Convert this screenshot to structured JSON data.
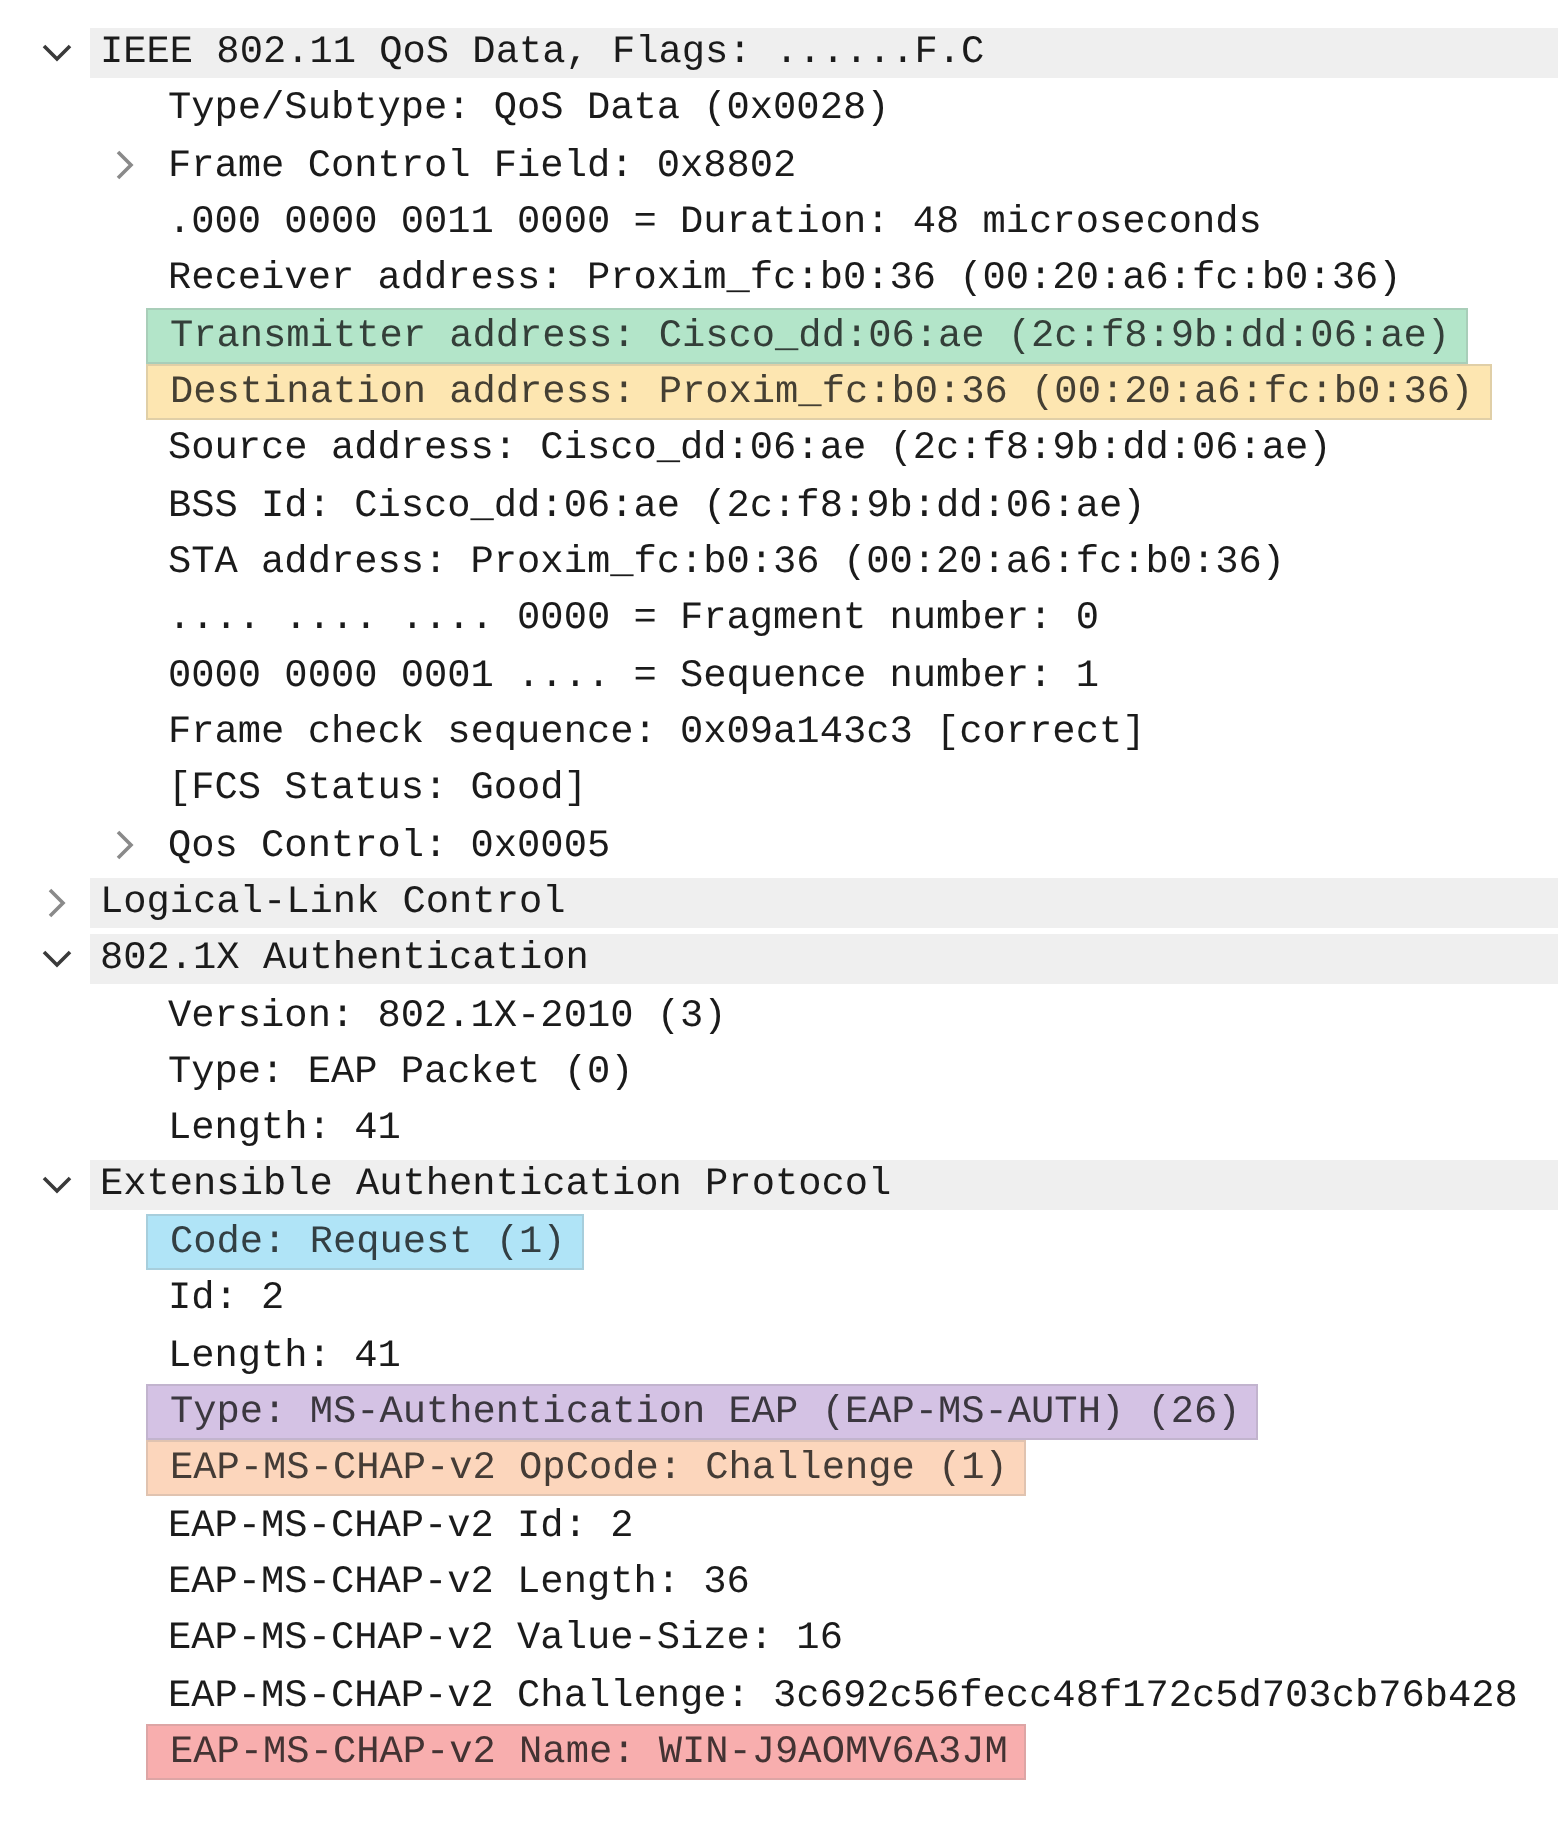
{
  "tree": [
    {
      "text": "IEEE 802.11 QoS Data, Flags: ......F.C",
      "expanded": true,
      "children": [
        {
          "text": "Type/Subtype: QoS Data (0x0028)"
        },
        {
          "text": "Frame Control Field: 0x8802",
          "expanded": false
        },
        {
          "text": ".000 0000 0011 0000 = Duration: 48 microseconds"
        },
        {
          "text": "Receiver address: Proxim_fc:b0:36 (00:20:a6:fc:b0:36)"
        },
        {
          "text": "Transmitter address: Cisco_dd:06:ae (2c:f8:9b:dd:06:ae)",
          "color": "#b3e5c9"
        },
        {
          "text": "Destination address: Proxim_fc:b0:36 (00:20:a6:fc:b0:36)",
          "color": "#fde6b1"
        },
        {
          "text": "Source address: Cisco_dd:06:ae (2c:f8:9b:dd:06:ae)"
        },
        {
          "text": "BSS Id: Cisco_dd:06:ae (2c:f8:9b:dd:06:ae)"
        },
        {
          "text": "STA address: Proxim_fc:b0:36 (00:20:a6:fc:b0:36)"
        },
        {
          "text": ".... .... .... 0000 = Fragment number: 0"
        },
        {
          "text": "0000 0000 0001 .... = Sequence number: 1"
        },
        {
          "text": "Frame check sequence: 0x09a143c3 [correct]"
        },
        {
          "text": "[FCS Status: Good]"
        },
        {
          "text": "Qos Control: 0x0005",
          "expanded": false
        }
      ]
    },
    {
      "text": "Logical-Link Control",
      "expanded": false
    },
    {
      "text": "802.1X Authentication",
      "expanded": true,
      "children": [
        {
          "text": "Version: 802.1X-2010 (3)"
        },
        {
          "text": "Type: EAP Packet (0)"
        },
        {
          "text": "Length: 41"
        }
      ]
    },
    {
      "text": "Extensible Authentication Protocol",
      "expanded": true,
      "children": [
        {
          "text": "Code: Request (1)",
          "color": "#b0e4f7"
        },
        {
          "text": "Id: 2"
        },
        {
          "text": "Length: 41"
        },
        {
          "text": "Type: MS-Authentication EAP (EAP-MS-AUTH) (26)",
          "color": "#d4c2e4"
        },
        {
          "text": "EAP-MS-CHAP-v2 OpCode: Challenge (1)",
          "color": "#fcd6bc"
        },
        {
          "text": "EAP-MS-CHAP-v2 Id: 2"
        },
        {
          "text": "EAP-MS-CHAP-v2 Length: 36"
        },
        {
          "text": "EAP-MS-CHAP-v2 Value-Size: 16"
        },
        {
          "text": "EAP-MS-CHAP-v2 Challenge: 3c692c56fecc48f172c5d703cb76b428"
        },
        {
          "text": "EAP-MS-CHAP-v2 Name: WIN-J9AOMV6A3JM",
          "color": "#f8aeae"
        }
      ]
    }
  ]
}
